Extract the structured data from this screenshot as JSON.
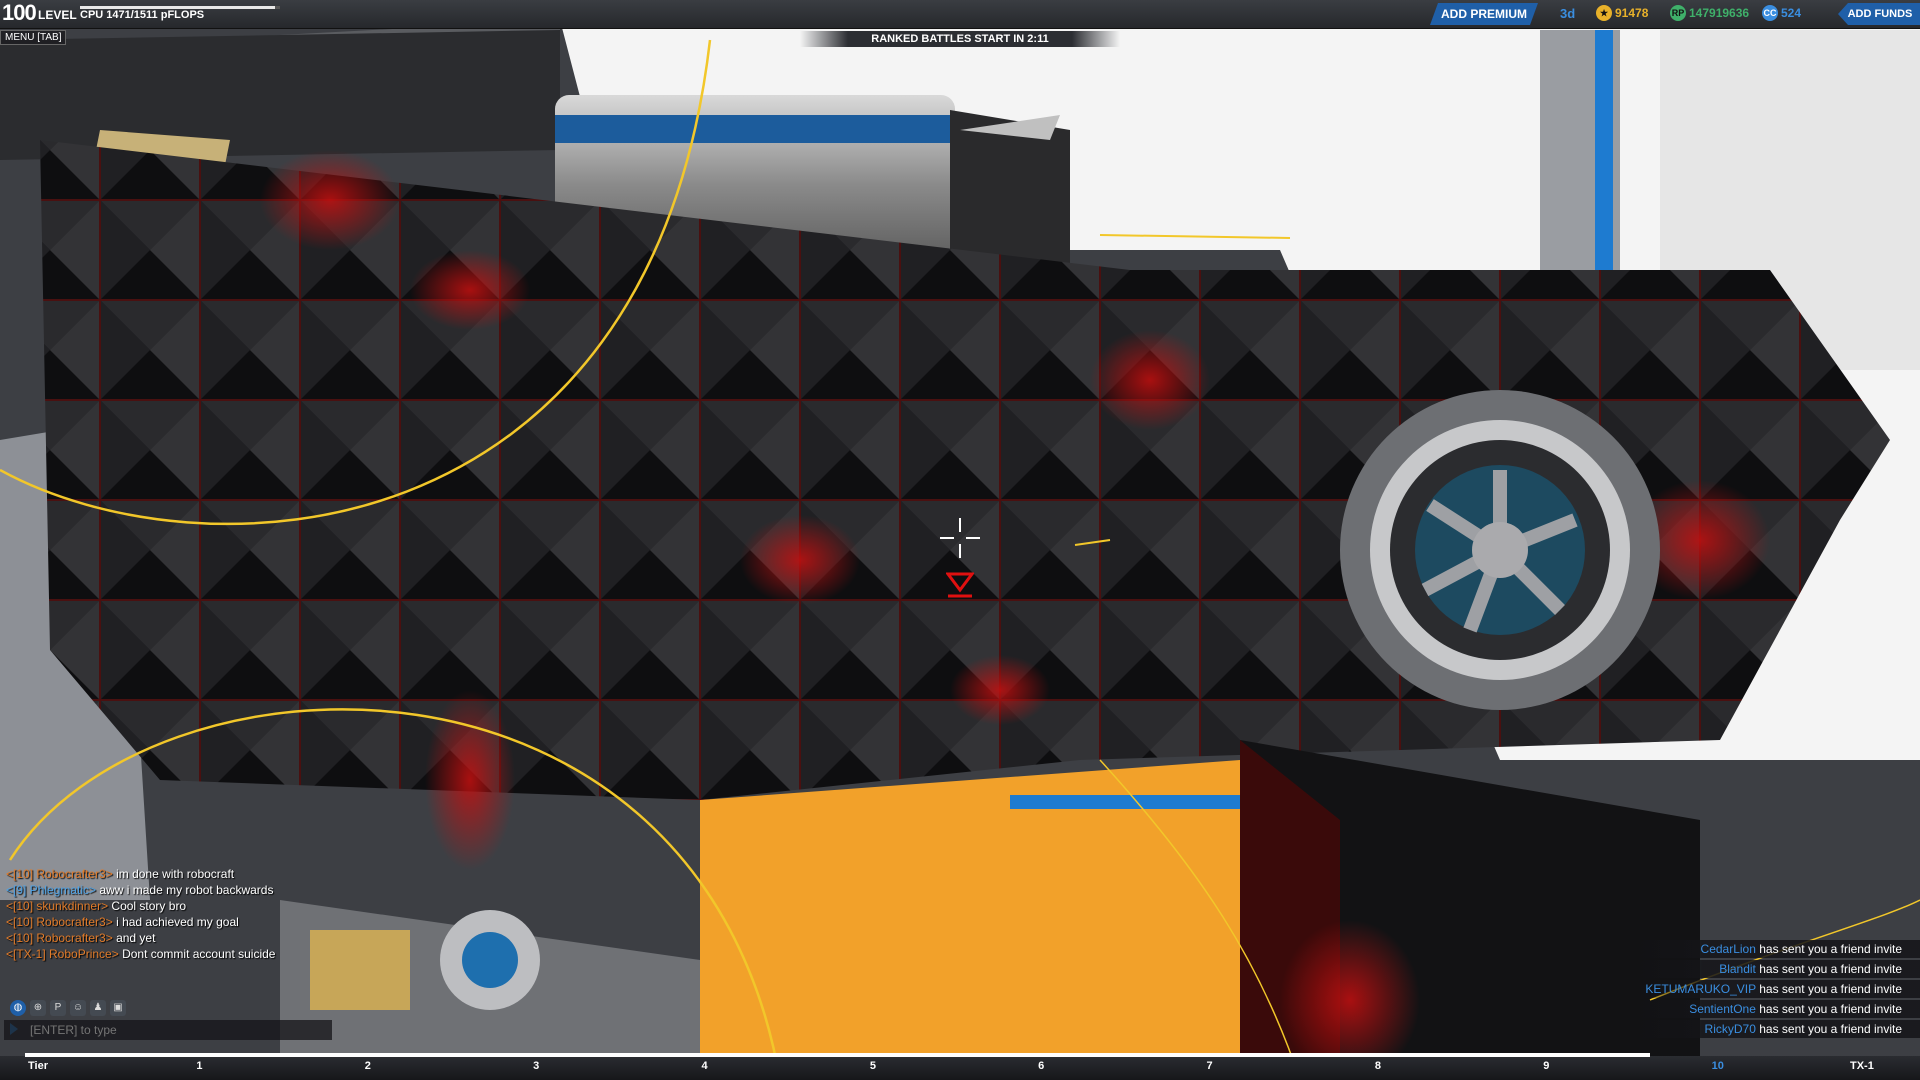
{
  "topbar": {
    "level_number": "100",
    "level_label": "LEVEL",
    "cpu_text": "CPU 1471/1511 pFLOPS",
    "cpu_fill_fraction": 0.973,
    "menu_label": "MENU [TAB]",
    "ranked_banner": "RANKED BATTLES START IN 2:11",
    "add_premium_label": "ADD PREMIUM",
    "premium_days": "3d",
    "currencies": [
      {
        "icon": "robits-icon",
        "value": "91478",
        "color": "#e8b12a"
      },
      {
        "icon": "rp-icon",
        "value": "147919636",
        "color": "#3fb06a"
      },
      {
        "icon": "cosmetic-credits-icon",
        "value": "524",
        "color": "#3a8ee0"
      }
    ],
    "add_funds_label": "ADD FUNDS"
  },
  "chat": {
    "messages": [
      {
        "name": "<[10] Robocrafter3>",
        "text": " im done with robocraft",
        "name_color": "orange"
      },
      {
        "name": "<[9] Phlegmatic>",
        "text": " aww i made my robot backwards",
        "name_color": "blue"
      },
      {
        "name": "<[10] skunkdinner>",
        "text": " Cool story bro",
        "name_color": "orange"
      },
      {
        "name": "<[10] Robocrafter3>",
        "text": " i had achieved my goal",
        "name_color": "orange"
      },
      {
        "name": "<[10] Robocrafter3>",
        "text": " and yet",
        "name_color": "orange"
      },
      {
        "name": "<[TX-1] RoboPrince>",
        "text": " Dont commit account suicide",
        "name_color": "orange"
      }
    ],
    "input_placeholder": "[ENTER] to type",
    "icons": [
      "globe-icon",
      "party-icon",
      "p-icon",
      "friends-icon",
      "clan-icon",
      "custom-icon"
    ]
  },
  "invites": [
    {
      "name": "CedarLion",
      "text": " has sent you a friend invite"
    },
    {
      "name": "Blandit",
      "text": " has sent you a friend invite"
    },
    {
      "name": "KETUMARUKO_VIP",
      "text": " has sent you a friend invite"
    },
    {
      "name": "SentientOne",
      "text": " has sent you a friend invite"
    },
    {
      "name": "RickyD70",
      "text": " has sent you a friend invite"
    }
  ],
  "tierbar": {
    "marks": [
      "Tier",
      "1",
      "2",
      "3",
      "4",
      "5",
      "6",
      "7",
      "8",
      "9",
      "10",
      "TX-1"
    ],
    "current": "10",
    "progress_fraction": 0.86
  },
  "colors": {
    "accent_blue": "#1f5fa8",
    "chat_name_orange": "#e07b2a",
    "chat_name_blue": "#4fa3e6"
  }
}
